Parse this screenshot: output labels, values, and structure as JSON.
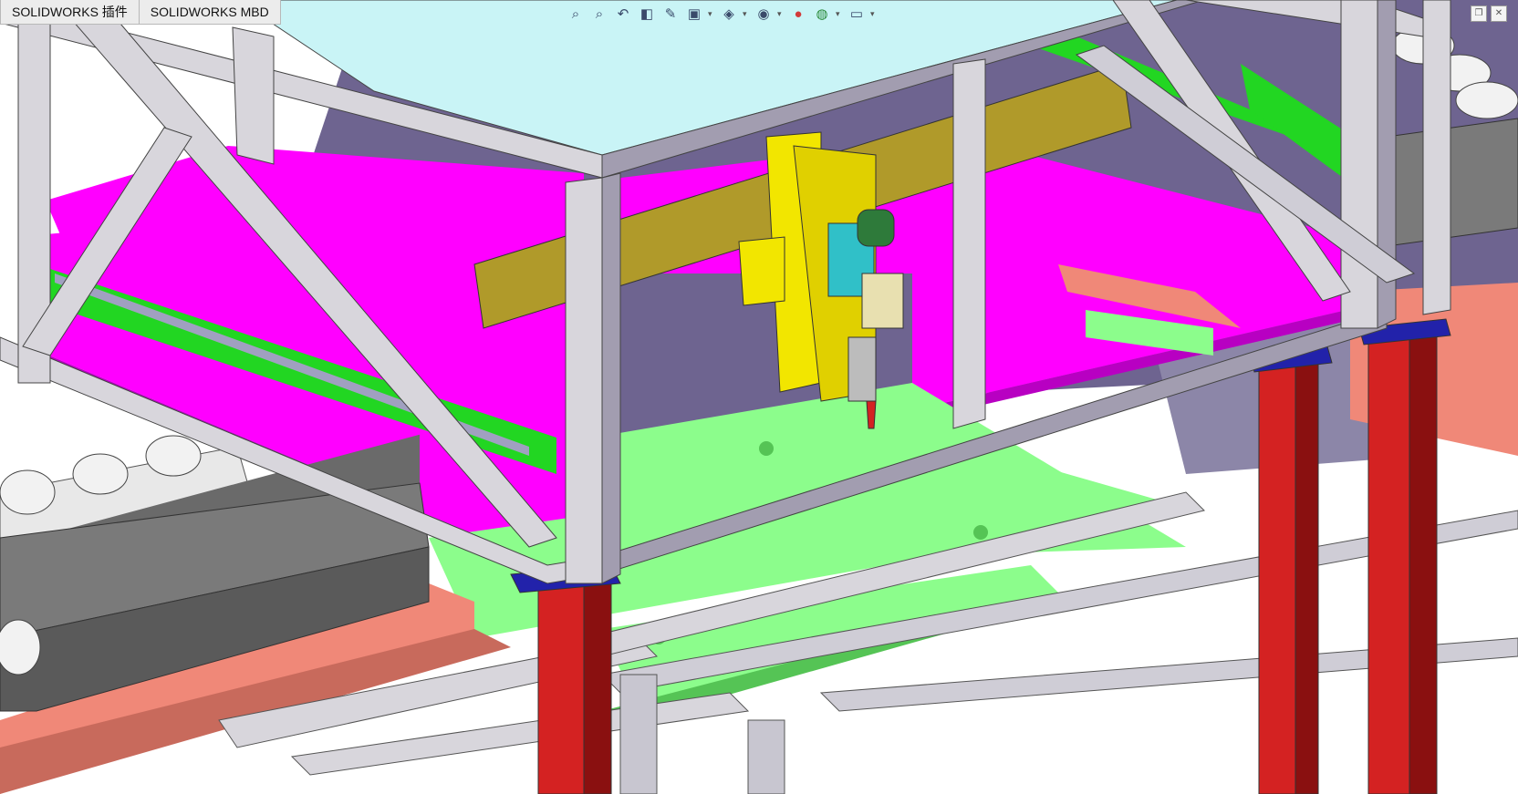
{
  "tabs": [
    {
      "label": "SOLIDWORKS 插件"
    },
    {
      "label": "SOLIDWORKS MBD"
    }
  ],
  "heads_up_toolbar": [
    {
      "icon": "zoom-to-fit-icon",
      "glyph": "🔍"
    },
    {
      "icon": "zoom-to-area-icon",
      "glyph": "🔎"
    },
    {
      "icon": "previous-view-icon",
      "glyph": "↶"
    },
    {
      "icon": "section-view-icon",
      "glyph": "◧"
    },
    {
      "icon": "dynamic-annotation-icon",
      "glyph": "✎"
    },
    {
      "icon": "view-orientation-icon",
      "glyph": "⬚"
    },
    {
      "icon": "display-style-icon",
      "glyph": "◈"
    },
    {
      "icon": "hide-show-items-icon",
      "glyph": "◉"
    },
    {
      "icon": "edit-appearance-icon",
      "glyph": "●"
    },
    {
      "icon": "apply-scene-icon",
      "glyph": "◍"
    },
    {
      "icon": "view-settings-icon",
      "glyph": "▭"
    }
  ],
  "colors": {
    "frame_light": "#d8d6dc",
    "frame_mid": "#a29db0",
    "frame_dark": "#7a7488",
    "top_panel": "#c9f4f6",
    "magenta": "#ff00ff",
    "magenta_dark": "#b800c2",
    "green_plate": "#8cfd8c",
    "green_rail": "#22d622",
    "yellow": "#f2e600",
    "gold_plate": "#b09a2a",
    "red_leg": "#d42222",
    "salmon": "#f08878",
    "violet_shadow": "#6e6490",
    "blue_accent": "#2222aa"
  }
}
